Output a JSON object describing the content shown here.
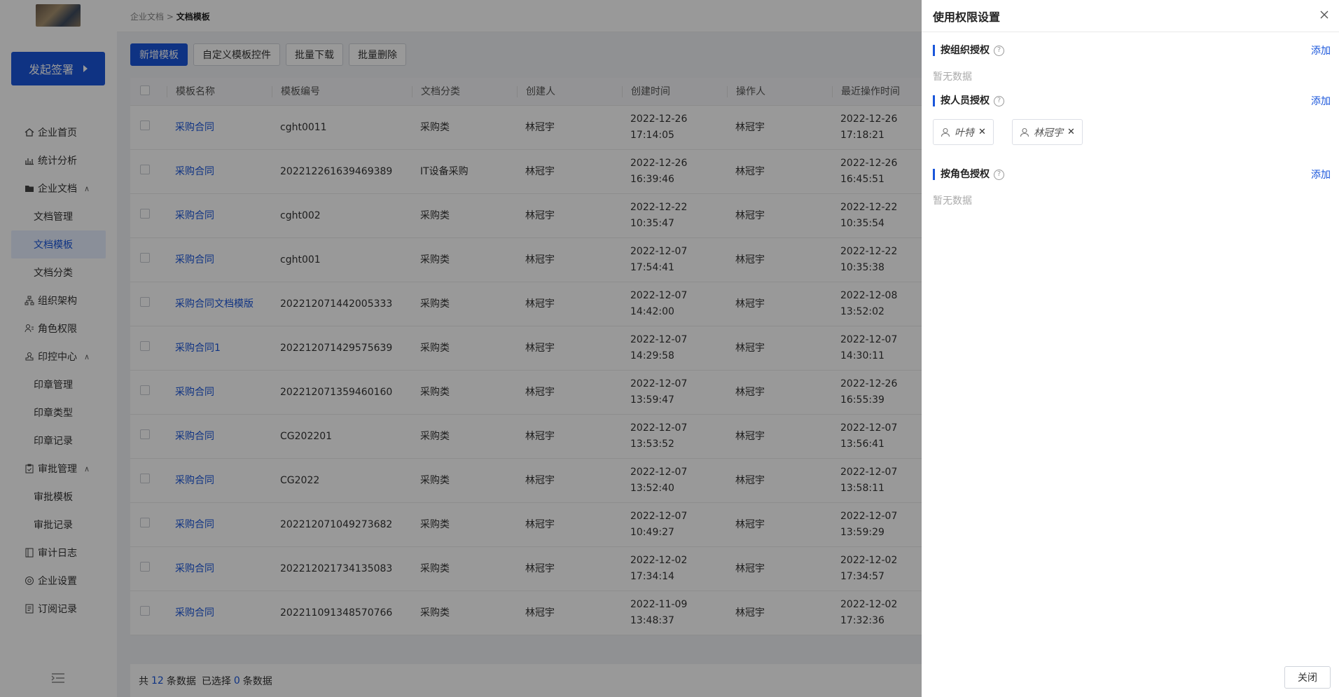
{
  "sidebar": {
    "start_button": "发起签署",
    "items": [
      {
        "label": "企业首页",
        "icon": "home-icon"
      },
      {
        "label": "统计分析",
        "icon": "bar-chart-icon"
      },
      {
        "label": "企业文档",
        "icon": "folder-icon",
        "expanded": true
      },
      {
        "label": "文档管理",
        "sub": true
      },
      {
        "label": "文档模板",
        "sub": true,
        "active": true
      },
      {
        "label": "文档分类",
        "sub": true
      },
      {
        "label": "组织架构",
        "icon": "org-chart-icon"
      },
      {
        "label": "角色权限",
        "icon": "user-role-icon"
      },
      {
        "label": "印控中心",
        "icon": "seal-icon",
        "expanded": true
      },
      {
        "label": "印章管理",
        "sub": true
      },
      {
        "label": "印章类型",
        "sub": true
      },
      {
        "label": "印章记录",
        "sub": true
      },
      {
        "label": "审批管理",
        "icon": "clipboard-icon",
        "expanded": true
      },
      {
        "label": "审批模板",
        "sub": true
      },
      {
        "label": "审批记录",
        "sub": true
      },
      {
        "label": "审计日志",
        "icon": "book-icon"
      },
      {
        "label": "企业设置",
        "icon": "settings-icon"
      },
      {
        "label": "订阅记录",
        "icon": "list-doc-icon"
      }
    ]
  },
  "breadcrumb": {
    "parent": "企业文档",
    "sep": ">",
    "current": "文档模板"
  },
  "toolbar": {
    "add": "新增模板",
    "custom": "自定义模板控件",
    "download": "批量下载",
    "delete": "批量删除"
  },
  "table": {
    "headers": [
      "模板名称",
      "模板编号",
      "文档分类",
      "创建人",
      "创建时间",
      "操作人",
      "最近操作时间"
    ],
    "rows": [
      {
        "name": "采购合同",
        "code": "cght0011",
        "category": "采购类",
        "creator": "林冠宇",
        "ctime_d": "2022-12-26",
        "ctime_t": "17:14:05",
        "operator": "林冠宇",
        "mtime_d": "2022-12-26",
        "mtime_t": "17:18:21"
      },
      {
        "name": "采购合同",
        "code": "202212261639469389",
        "category": "IT设备采购",
        "creator": "林冠宇",
        "ctime_d": "2022-12-26",
        "ctime_t": "16:39:46",
        "operator": "林冠宇",
        "mtime_d": "2022-12-26",
        "mtime_t": "16:45:51"
      },
      {
        "name": "采购合同",
        "code": "cght002",
        "category": "采购类",
        "creator": "林冠宇",
        "ctime_d": "2022-12-22",
        "ctime_t": "10:35:47",
        "operator": "林冠宇",
        "mtime_d": "2022-12-22",
        "mtime_t": "10:35:54"
      },
      {
        "name": "采购合同",
        "code": "cght001",
        "category": "采购类",
        "creator": "林冠宇",
        "ctime_d": "2022-12-07",
        "ctime_t": "17:54:41",
        "operator": "林冠宇",
        "mtime_d": "2022-12-22",
        "mtime_t": "10:35:38"
      },
      {
        "name": "采购合同文档模版",
        "code": "202212071442005333",
        "category": "采购类",
        "creator": "林冠宇",
        "ctime_d": "2022-12-07",
        "ctime_t": "14:42:00",
        "operator": "林冠宇",
        "mtime_d": "2022-12-08",
        "mtime_t": "13:52:02"
      },
      {
        "name": "采购合同1",
        "code": "202212071429575639",
        "category": "采购类",
        "creator": "林冠宇",
        "ctime_d": "2022-12-07",
        "ctime_t": "14:29:58",
        "operator": "林冠宇",
        "mtime_d": "2022-12-07",
        "mtime_t": "14:30:11"
      },
      {
        "name": "采购合同",
        "code": "202212071359460160",
        "category": "采购类",
        "creator": "林冠宇",
        "ctime_d": "2022-12-07",
        "ctime_t": "13:59:47",
        "operator": "林冠宇",
        "mtime_d": "2022-12-26",
        "mtime_t": "16:55:39"
      },
      {
        "name": "采购合同",
        "code": "CG202201",
        "category": "采购类",
        "creator": "林冠宇",
        "ctime_d": "2022-12-07",
        "ctime_t": "13:53:52",
        "operator": "林冠宇",
        "mtime_d": "2022-12-07",
        "mtime_t": "13:56:41"
      },
      {
        "name": "采购合同",
        "code": "CG2022",
        "category": "采购类",
        "creator": "林冠宇",
        "ctime_d": "2022-12-07",
        "ctime_t": "13:52:40",
        "operator": "林冠宇",
        "mtime_d": "2022-12-07",
        "mtime_t": "13:58:11"
      },
      {
        "name": "采购合同",
        "code": "202212071049273682",
        "category": "采购类",
        "creator": "林冠宇",
        "ctime_d": "2022-12-07",
        "ctime_t": "10:49:27",
        "operator": "林冠宇",
        "mtime_d": "2022-12-07",
        "mtime_t": "13:59:29"
      },
      {
        "name": "采购合同",
        "code": "202212021734135083",
        "category": "采购类",
        "creator": "林冠宇",
        "ctime_d": "2022-12-02",
        "ctime_t": "17:34:14",
        "operator": "林冠宇",
        "mtime_d": "2022-12-02",
        "mtime_t": "17:34:57"
      },
      {
        "name": "采购合同",
        "code": "202211091348570766",
        "category": "采购类",
        "creator": "林冠宇",
        "ctime_d": "2022-11-09",
        "ctime_t": "13:48:37",
        "operator": "林冠宇",
        "mtime_d": "2022-12-02",
        "mtime_t": "17:32:36"
      }
    ]
  },
  "footer": {
    "prefix": "共",
    "total": "12",
    "mid": "条数据",
    "selected_prefix": "已选择",
    "selected": "0",
    "suffix": "条数据"
  },
  "drawer": {
    "title": "使用权限设置",
    "org_section": "按组织授权",
    "person_section": "按人员授权",
    "role_section": "按角色授权",
    "add": "添加",
    "empty": "暂无数据",
    "persons": [
      "叶特",
      "林冠宇"
    ],
    "close_button": "关闭"
  },
  "colors": {
    "accent": "#1a56db",
    "overlay": "rgba(0,0,0,0.40)"
  }
}
